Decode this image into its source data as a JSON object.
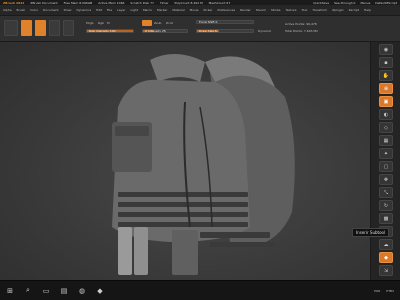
{
  "titlebar": {
    "app": "ZBrush 2021",
    "document": "ZBrush Document",
    "stats": [
      "Free Mem 8.096GB",
      "Active Mem 1066",
      "Scratch Disk 77",
      "Timer",
      "PolyCount 8.492 M",
      "MeshCount 67"
    ],
    "right": [
      "QuickSave",
      "See-through 0",
      "Menus",
      "DefaultZScript"
    ]
  },
  "menubar": {
    "items": [
      "Alpha",
      "Brush",
      "Color",
      "Document",
      "Draw",
      "Dynamics",
      "Edit",
      "File",
      "Layer",
      "Light",
      "Macro",
      "Marker",
      "Material",
      "Movie",
      "Picker",
      "Preferences",
      "Render",
      "Stencil",
      "Stroke",
      "Texture",
      "Tool",
      "Transform",
      "Zplugin",
      "Zscript",
      "Help"
    ]
  },
  "toolbar": {
    "labels": {
      "mrgb": "Mrgb",
      "rgb": "Rgb",
      "m": "M",
      "zadd": "Zadd",
      "zsub": "Zsub",
      "zcut": "Zcut",
      "rgb_intensity": "Rgb Intensity 100",
      "z_intensity": "Z Intensity 25",
      "focal_shift": "Focal Shift 0",
      "draw_size": "Draw Size 64",
      "dynamic": "Dynamic",
      "active_points": "Active Points: 96,478",
      "total_points": "Total Points: 7,693 Mil"
    },
    "rgb_intensity_level": 1.0,
    "z_intensity_level": 0.25,
    "draw_size_level": 0.35
  },
  "rightshelf": {
    "buttons": [
      "BPR",
      "SPix 3",
      "Scroll",
      "Zoom",
      "Actual",
      "AAHalf",
      "Persp",
      "Floor",
      "Local",
      "Frame",
      "Move",
      "Scale",
      "Rotate",
      "PolyF",
      "Transp",
      "Ghost",
      "Solo",
      "Xpose"
    ]
  },
  "tooltip": "Inserir Subtool",
  "taskbar": {
    "right": [
      "POR",
      "PTB2"
    ]
  }
}
